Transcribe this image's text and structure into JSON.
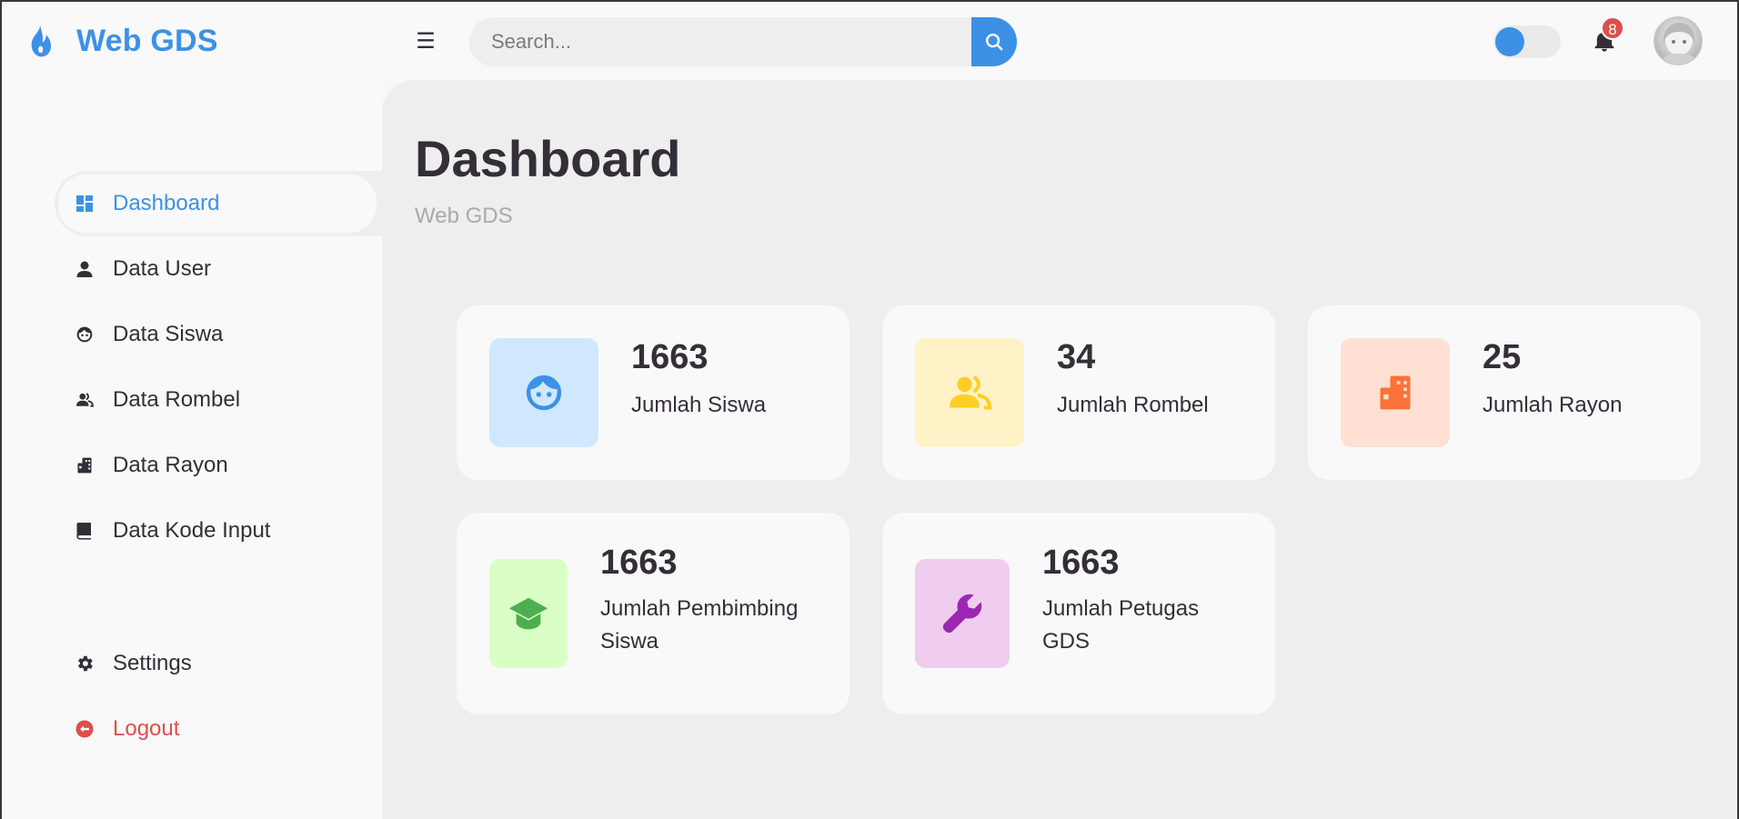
{
  "app": {
    "name": "Web GDS"
  },
  "search": {
    "placeholder": "Search..."
  },
  "notifications": {
    "count": "8"
  },
  "sidebar": {
    "items": [
      {
        "label": "Dashboard"
      },
      {
        "label": "Data User"
      },
      {
        "label": "Data Siswa"
      },
      {
        "label": "Data Rombel"
      },
      {
        "label": "Data Rayon"
      },
      {
        "label": "Data Kode Input"
      }
    ],
    "bottom": [
      {
        "label": "Settings"
      },
      {
        "label": "Logout"
      }
    ]
  },
  "main": {
    "title": "Dashboard",
    "subtitle": "Web GDS",
    "cards": [
      {
        "value": "1663",
        "label": "Jumlah Siswa",
        "icon": "face-icon",
        "bg": "#cfe8ff",
        "color": "#3c91e6"
      },
      {
        "value": "34",
        "label": "Jumlah Rombel",
        "icon": "group-icon",
        "bg": "#fff2c6",
        "color": "#ffce26"
      },
      {
        "value": "25",
        "label": "Jumlah Rayon",
        "icon": "building-icon",
        "bg": "#ffe0d3",
        "color": "#fd7238"
      },
      {
        "value": "1663",
        "label": "Jumlah Pembimbing Siswa",
        "icon": "graduation-cap-icon",
        "bg": "#d9ffc7",
        "color": "#4caf50"
      },
      {
        "value": "1663",
        "label": "Jumlah Petugas GDS",
        "icon": "wrench-icon",
        "bg": "#f0cdee",
        "color": "#9c27b0"
      }
    ]
  },
  "colors": {
    "accent": "#3c91e6",
    "danger": "#db504a",
    "text": "#342e37"
  }
}
